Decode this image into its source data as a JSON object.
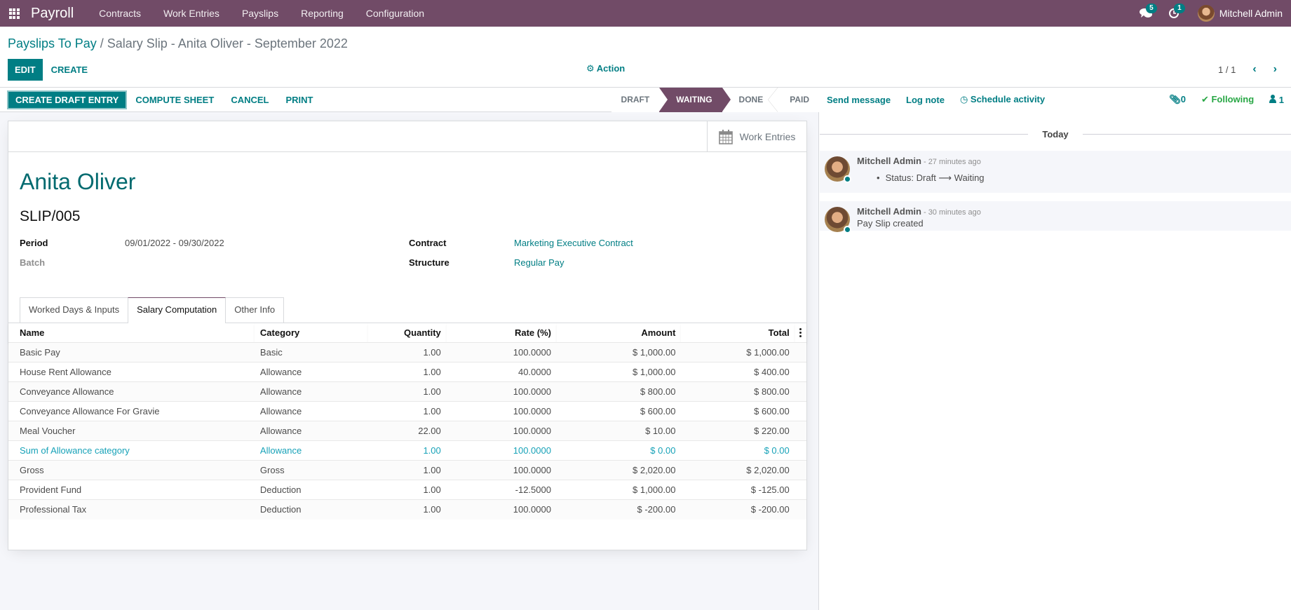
{
  "navbar": {
    "app_name": "Payroll",
    "menu": [
      "Contracts",
      "Work Entries",
      "Payslips",
      "Reporting",
      "Configuration"
    ],
    "messages_count": "5",
    "activities_count": "1",
    "user_name": "Mitchell Admin"
  },
  "breadcrumb": {
    "parent": "Payslips To Pay",
    "separator": " / ",
    "current": "Salary Slip - Anita Oliver - September 2022"
  },
  "control_panel": {
    "edit_label": "EDIT",
    "create_label": "CREATE",
    "action_label": "Action",
    "pager": "1 / 1",
    "prev_glyph": "‹",
    "next_glyph": "›"
  },
  "statusbar": {
    "buttons": [
      "CREATE DRAFT ENTRY",
      "COMPUTE SHEET",
      "CANCEL",
      "PRINT"
    ],
    "stages": [
      "DRAFT",
      "WAITING",
      "DONE",
      "PAID"
    ],
    "active_stage": "WAITING"
  },
  "smart_button": {
    "label": "Work Entries"
  },
  "form": {
    "employee": "Anita Oliver",
    "number": "SLIP/005",
    "period_label": "Period",
    "period_value": "09/01/2022 - 09/30/2022",
    "batch_label": "Batch",
    "contract_label": "Contract",
    "contract_value": "Marketing Executive Contract",
    "structure_label": "Structure",
    "structure_value": "Regular Pay"
  },
  "tabs": [
    "Worked Days & Inputs",
    "Salary Computation",
    "Other Info"
  ],
  "active_tab": "Salary Computation",
  "table": {
    "headers": [
      "Name",
      "Category",
      "Quantity",
      "Rate (%)",
      "Amount",
      "Total"
    ],
    "rows": [
      {
        "name": "Basic Pay",
        "category": "Basic",
        "quantity": "1.00",
        "rate": "100.0000",
        "amount": "$ 1,000.00",
        "total": "$ 1,000.00"
      },
      {
        "name": "House Rent Allowance",
        "category": "Allowance",
        "quantity": "1.00",
        "rate": "40.0000",
        "amount": "$ 1,000.00",
        "total": "$ 400.00"
      },
      {
        "name": "Conveyance Allowance",
        "category": "Allowance",
        "quantity": "1.00",
        "rate": "100.0000",
        "amount": "$ 800.00",
        "total": "$ 800.00"
      },
      {
        "name": "Conveyance Allowance For Gravie",
        "category": "Allowance",
        "quantity": "1.00",
        "rate": "100.0000",
        "amount": "$ 600.00",
        "total": "$ 600.00"
      },
      {
        "name": "Meal Voucher",
        "category": "Allowance",
        "quantity": "22.00",
        "rate": "100.0000",
        "amount": "$ 10.00",
        "total": "$ 220.00"
      },
      {
        "name": "Sum of Allowance category",
        "category": "Allowance",
        "quantity": "1.00",
        "rate": "100.0000",
        "amount": "$ 0.00",
        "total": "$ 0.00"
      },
      {
        "name": "Gross",
        "category": "Gross",
        "quantity": "1.00",
        "rate": "100.0000",
        "amount": "$ 2,020.00",
        "total": "$ 2,020.00"
      },
      {
        "name": "Provident Fund",
        "category": "Deduction",
        "quantity": "1.00",
        "rate": "-12.5000",
        "amount": "$ 1,000.00",
        "total": "$ -125.00"
      },
      {
        "name": "Professional Tax",
        "category": "Deduction",
        "quantity": "1.00",
        "rate": "100.0000",
        "amount": "$ -200.00",
        "total": "$ -200.00"
      }
    ]
  },
  "chatter": {
    "send_message": "Send message",
    "log_note": "Log note",
    "schedule_activity": "Schedule activity",
    "attachments_count": "0",
    "following_label": "Following",
    "followers_count": "1",
    "date_separator": "Today",
    "messages": [
      {
        "author": "Mitchell Admin",
        "date": "- 27 minutes ago",
        "tracking": "Status: Draft ⟶ Waiting"
      },
      {
        "author": "Mitchell Admin",
        "date": "- 30 minutes ago",
        "text": "Pay Slip created"
      }
    ]
  },
  "colors": {
    "brand": "#714b67",
    "primary": "#017e84",
    "highlight_row": "#17a2b8",
    "following": "#28a745"
  }
}
